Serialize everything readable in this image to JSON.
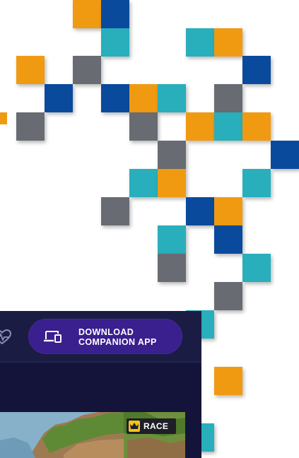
{
  "decoration": {
    "tiles": [
      {
        "color": "orange"
      },
      {
        "color": "blue"
      },
      {
        "color": "teal"
      },
      {
        "color": "teal"
      },
      {
        "color": "orange"
      },
      {
        "color": "orange"
      },
      {
        "color": "gray"
      },
      {
        "color": "blue"
      },
      {
        "color": "blue"
      },
      {
        "color": "blue"
      },
      {
        "color": "orange"
      },
      {
        "color": "teal"
      },
      {
        "color": "gray"
      },
      {
        "color": "orange"
      },
      {
        "color": "gray"
      },
      {
        "color": "gray"
      },
      {
        "color": "orange"
      },
      {
        "color": "teal"
      },
      {
        "color": "orange"
      },
      {
        "color": "gray"
      },
      {
        "color": "blue"
      },
      {
        "color": "teal"
      },
      {
        "color": "orange"
      },
      {
        "color": "teal"
      },
      {
        "color": "gray"
      },
      {
        "color": "blue"
      },
      {
        "color": "orange"
      },
      {
        "color": "teal"
      },
      {
        "color": "blue"
      },
      {
        "color": "gray"
      },
      {
        "color": "teal"
      },
      {
        "color": "gray"
      },
      {
        "color": "teal"
      },
      {
        "color": "orange"
      },
      {
        "color": "teal"
      }
    ],
    "palette": {
      "orange": "#f09a12",
      "teal": "#29aebc",
      "blue": "#0a4a9c",
      "gray": "#686c72"
    }
  },
  "header": {
    "left_icon": "heart-pulse-icon",
    "download_button": {
      "icon": "devices-icon",
      "line1": "DOWNLOAD",
      "line2": "COMPANION APP"
    }
  },
  "card": {
    "badge": {
      "icon": "crown-icon",
      "label": "RACE"
    }
  },
  "colors": {
    "app_background": "#14143a",
    "header_background": "#1b1c44",
    "button_background": "#3a1f8e",
    "badge_accent": "#f3c21a"
  }
}
